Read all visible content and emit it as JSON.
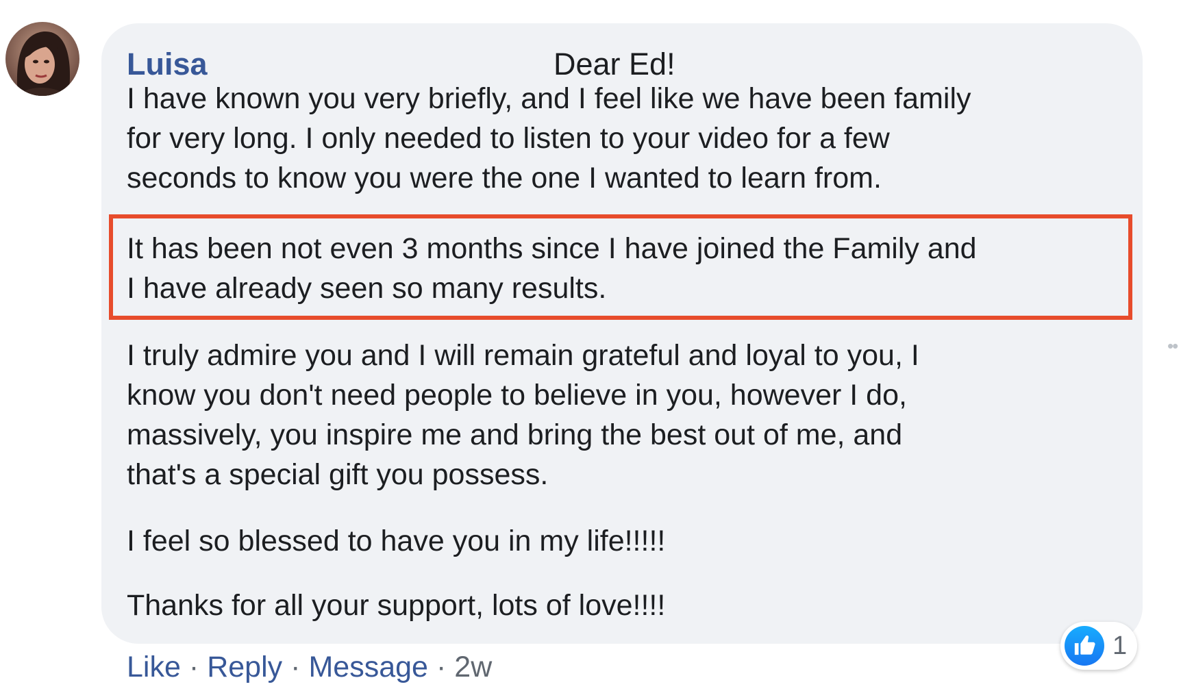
{
  "comment": {
    "author": "Luisa",
    "greeting": "Dear Ed!",
    "paragraphs": [
      {
        "lines": [
          "I have known you very briefly, and I feel like we have been family",
          "for very long. I only needed to listen to your video for a few",
          "seconds to know you were the one I wanted to learn from."
        ]
      },
      {
        "lines": [
          "It has been not even 3 months since I have joined the Family and",
          "I have already seen so many results."
        ]
      },
      {
        "lines": [
          "I truly admire you and I will remain grateful and loyal to you, I",
          "know you don't need people to believe in you, however I do,",
          "massively, you inspire me and bring the best out of me, and",
          "that's a special gift you possess."
        ]
      },
      {
        "lines": [
          "I feel so blessed to have you in my life!!!!!"
        ]
      },
      {
        "lines": [
          "Thanks for all your support, lots of love!!!!"
        ]
      }
    ]
  },
  "actions": {
    "like": "Like",
    "reply": "Reply",
    "message": "Message",
    "separator": "·",
    "timestamp": "2w"
  },
  "reactions": {
    "icon": "like-reaction-icon",
    "count": "1",
    "color": "#1877f2"
  },
  "colors": {
    "author_link": "#385898",
    "bubble_bg": "#f0f2f5",
    "highlight_border": "#e74c2c",
    "meta_text": "#606770"
  }
}
